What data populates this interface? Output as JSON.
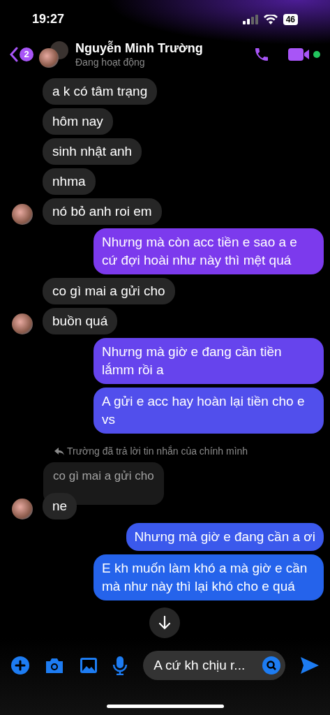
{
  "status_bar": {
    "time": "19:27",
    "battery": "46"
  },
  "header": {
    "back_badge": "2",
    "name": "Nguyễn Minh Trường",
    "status": "Đang hoạt động",
    "online": true
  },
  "messages": [
    {
      "kind": "incoming",
      "text": "a k có tâm trạng",
      "avatar": false
    },
    {
      "kind": "incoming",
      "text": "hôm nay",
      "avatar": false
    },
    {
      "kind": "incoming",
      "text": "sinh nhật anh",
      "avatar": false
    },
    {
      "kind": "incoming",
      "text": "nhma",
      "avatar": false
    },
    {
      "kind": "incoming",
      "text": "nó bỏ anh roi em",
      "avatar": true
    },
    {
      "kind": "outgoing",
      "text": "Nhưng mà còn acc tiền e sao a e cứ đợi hoài như này thì mệt quá"
    },
    {
      "kind": "incoming",
      "text": "co gì mai a gửi cho",
      "avatar": false
    },
    {
      "kind": "incoming",
      "text": "buồn quá",
      "avatar": true
    },
    {
      "kind": "outgoing",
      "text": "Nhưng mà giờ e đang cần tiền lắmm rồi a"
    },
    {
      "kind": "outgoing",
      "text": "A gửi e acc hay hoàn lại tiền cho e vs"
    },
    {
      "kind": "reply_note",
      "text": "Trường đã trả lời tin nhắn của chính mình"
    },
    {
      "kind": "quoted",
      "text": "co gì mai a gửi cho"
    },
    {
      "kind": "incoming",
      "text": "ne",
      "avatar": true
    },
    {
      "kind": "outgoing",
      "text": "Nhưng mà giờ e đang cần a ơi"
    },
    {
      "kind": "outgoing",
      "text": "E kh muốn làm khó a mà giờ e cần mà như này thì lại khó cho e quá"
    }
  ],
  "composer": {
    "value": "A cứ kh chịu r..."
  }
}
